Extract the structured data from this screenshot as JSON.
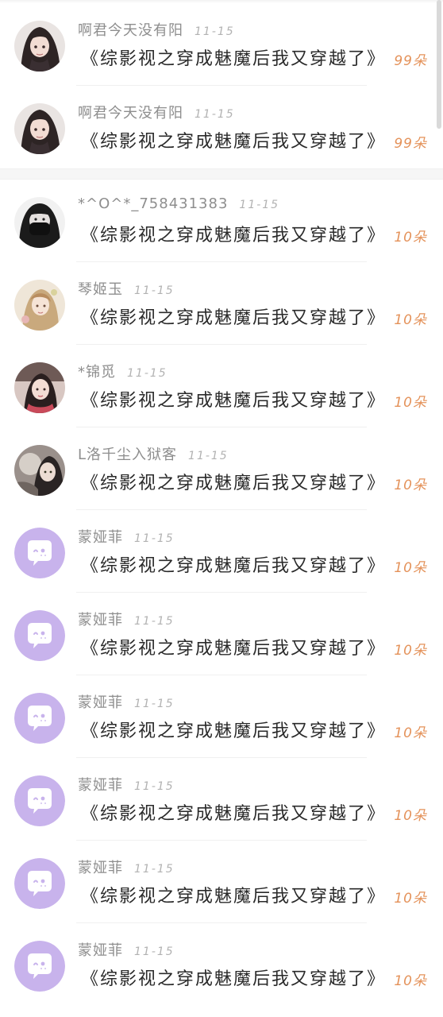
{
  "colors": {
    "amount": "#e4925a",
    "name": "#8e8e8e",
    "date": "#b2b2b2",
    "title": "#2a2a2a",
    "default_avatar_bg": "#c8b3ec"
  },
  "top_section": {
    "items": [
      {
        "name": "啊君今天没有阳",
        "date": "11-15",
        "title": "《综影视之穿成魅魔后我又穿越了》",
        "amount": "99朵",
        "avatar": "anime-girl-avatar"
      },
      {
        "name": "啊君今天没有阳",
        "date": "11-15",
        "title": "《综影视之穿成魅魔后我又穿越了》",
        "amount": "99朵",
        "avatar": "anime-girl-avatar"
      }
    ]
  },
  "main_section": {
    "items": [
      {
        "name": "*^O^*_758431383",
        "date": "11-15",
        "title": "《综影视之穿成魅魔后我又穿越了》",
        "amount": "10朵",
        "avatar": "masked-girl-avatar"
      },
      {
        "name": "琴姬玉",
        "date": "11-15",
        "title": "《综影视之穿成魅魔后我又穿越了》",
        "amount": "10朵",
        "avatar": "illustrated-girl-avatar"
      },
      {
        "name": "*锦觅",
        "date": "11-15",
        "title": "《综影视之穿成魅魔后我又穿越了》",
        "amount": "10朵",
        "avatar": "costume-girl-avatar"
      },
      {
        "name": "L洛千尘入狱客",
        "date": "11-15",
        "title": "《综影视之穿成魅魔后我又穿越了》",
        "amount": "10朵",
        "avatar": "fan-girl-avatar"
      },
      {
        "name": "蒙娅菲",
        "date": "11-15",
        "title": "《综影视之穿成魅魔后我又穿越了》",
        "amount": "10朵",
        "avatar": "default-chat-avatar"
      },
      {
        "name": "蒙娅菲",
        "date": "11-15",
        "title": "《综影视之穿成魅魔后我又穿越了》",
        "amount": "10朵",
        "avatar": "default-chat-avatar"
      },
      {
        "name": "蒙娅菲",
        "date": "11-15",
        "title": "《综影视之穿成魅魔后我又穿越了》",
        "amount": "10朵",
        "avatar": "default-chat-avatar"
      },
      {
        "name": "蒙娅菲",
        "date": "11-15",
        "title": "《综影视之穿成魅魔后我又穿越了》",
        "amount": "10朵",
        "avatar": "default-chat-avatar"
      },
      {
        "name": "蒙娅菲",
        "date": "11-15",
        "title": "《综影视之穿成魅魔后我又穿越了》",
        "amount": "10朵",
        "avatar": "default-chat-avatar"
      },
      {
        "name": "蒙娅菲",
        "date": "11-15",
        "title": "《综影视之穿成魅魔后我又穿越了》",
        "amount": "10朵",
        "avatar": "default-chat-avatar"
      }
    ]
  }
}
